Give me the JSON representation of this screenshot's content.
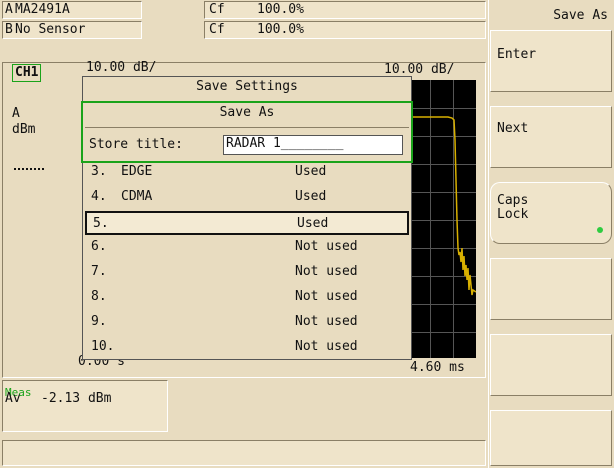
{
  "header": {
    "row1": {
      "sensor_label": "A",
      "sensor_name": "MA2491A",
      "cf_label": "Cf",
      "cf_value": "100.0%"
    },
    "row2": {
      "sensor_label": "B",
      "sensor_name": "No Sensor",
      "cf_label": "Cf",
      "cf_value": "100.0%"
    }
  },
  "channel": {
    "name": "CH1",
    "scale_left": "10.00 dB/",
    "scale_right": "10.00 dB/",
    "unit_line1": "A",
    "unit_line2": "dBm",
    "time_left": "0.00 s",
    "time_right": "4.60 ms"
  },
  "meas": {
    "label": "Meas",
    "type": "Av",
    "value": "-2.13 dBm"
  },
  "dialog": {
    "title": "Save Settings",
    "subtitle": "Save As",
    "store_title_label": "Store title:",
    "store_title_value": "RADAR 1________",
    "items": [
      {
        "num": "3.",
        "name": "EDGE",
        "status": "Used"
      },
      {
        "num": "4.",
        "name": "CDMA",
        "status": "Used"
      },
      {
        "num": "5.",
        "name": "",
        "status": "Used"
      },
      {
        "num": "6.",
        "name": "",
        "status": "Not used"
      },
      {
        "num": "7.",
        "name": "",
        "status": "Not used"
      },
      {
        "num": "8.",
        "name": "",
        "status": "Not used"
      },
      {
        "num": "9.",
        "name": "",
        "status": "Not used"
      },
      {
        "num": "10.",
        "name": "",
        "status": "Not used"
      }
    ],
    "selected_index": 2
  },
  "softkeys": {
    "title": "Save As",
    "enter": "Enter",
    "next": "Next",
    "caps_line1": "Caps",
    "caps_line2": "Lock",
    "caps_led_color": "#2ecc40"
  },
  "colors": {
    "accent_green": "#1aa31a",
    "trace_yellow": "#d8b000"
  }
}
